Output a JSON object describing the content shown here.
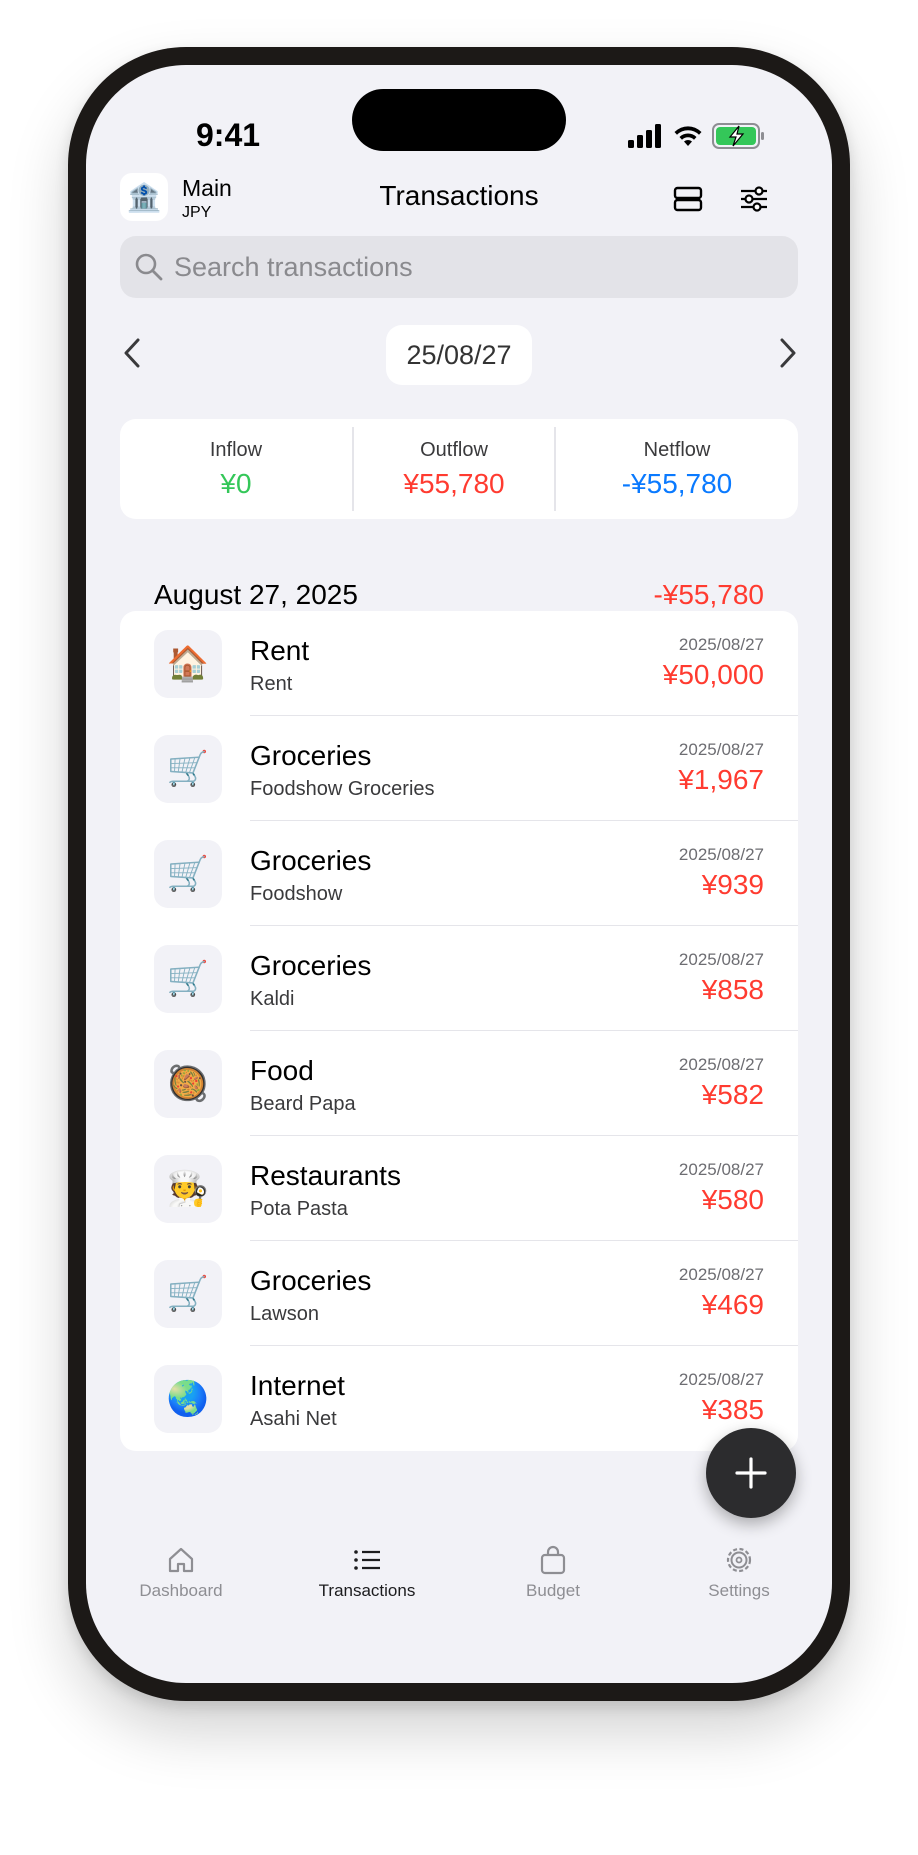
{
  "status_bar": {
    "time": "9:41"
  },
  "header": {
    "account_name": "Main",
    "account_currency": "JPY",
    "account_icon": "bank-icon",
    "title": "Transactions"
  },
  "search": {
    "placeholder": "Search transactions",
    "value": ""
  },
  "date_nav": {
    "current": "25/08/27"
  },
  "summary": {
    "inflow_label": "Inflow",
    "inflow_value": "¥0",
    "outflow_label": "Outflow",
    "outflow_value": "¥55,780",
    "netflow_label": "Netflow",
    "netflow_value": "-¥55,780"
  },
  "day_group": {
    "date": "August 27, 2025",
    "total": "-¥55,780"
  },
  "transactions": [
    {
      "icon": "🏠",
      "icon_name": "house-icon",
      "category": "Rent",
      "payee": "Rent",
      "date": "2025/08/27",
      "amount": "¥50,000"
    },
    {
      "icon": "🛒",
      "icon_name": "shopping-cart-icon",
      "category": "Groceries",
      "payee": "Foodshow Groceries",
      "date": "2025/08/27",
      "amount": "¥1,967"
    },
    {
      "icon": "🛒",
      "icon_name": "shopping-cart-icon",
      "category": "Groceries",
      "payee": "Foodshow",
      "date": "2025/08/27",
      "amount": "¥939"
    },
    {
      "icon": "🛒",
      "icon_name": "shopping-cart-icon",
      "category": "Groceries",
      "payee": "Kaldi",
      "date": "2025/08/27",
      "amount": "¥858"
    },
    {
      "icon": "🥘",
      "icon_name": "food-pan-icon",
      "category": "Food",
      "payee": "Beard Papa",
      "date": "2025/08/27",
      "amount": "¥582"
    },
    {
      "icon": "🧑‍🍳",
      "icon_name": "chef-icon",
      "category": "Restaurants",
      "payee": "Pota Pasta",
      "date": "2025/08/27",
      "amount": "¥580"
    },
    {
      "icon": "🛒",
      "icon_name": "shopping-cart-icon",
      "category": "Groceries",
      "payee": "Lawson",
      "date": "2025/08/27",
      "amount": "¥469"
    },
    {
      "icon": "🌏",
      "icon_name": "globe-icon",
      "category": "Internet",
      "payee": "Asahi Net",
      "date": "2025/08/27",
      "amount": "¥385"
    }
  ],
  "tabs": [
    {
      "label": "Dashboard",
      "icon": "home-icon",
      "active": false
    },
    {
      "label": "Transactions",
      "icon": "list-icon",
      "active": true
    },
    {
      "label": "Budget",
      "icon": "bag-icon",
      "active": false
    },
    {
      "label": "Settings",
      "icon": "gear-icon",
      "active": false
    }
  ],
  "colors": {
    "inflow": "#34c759",
    "outflow": "#ff3b30",
    "netflow": "#0a7aff",
    "background": "#f2f2f7"
  }
}
